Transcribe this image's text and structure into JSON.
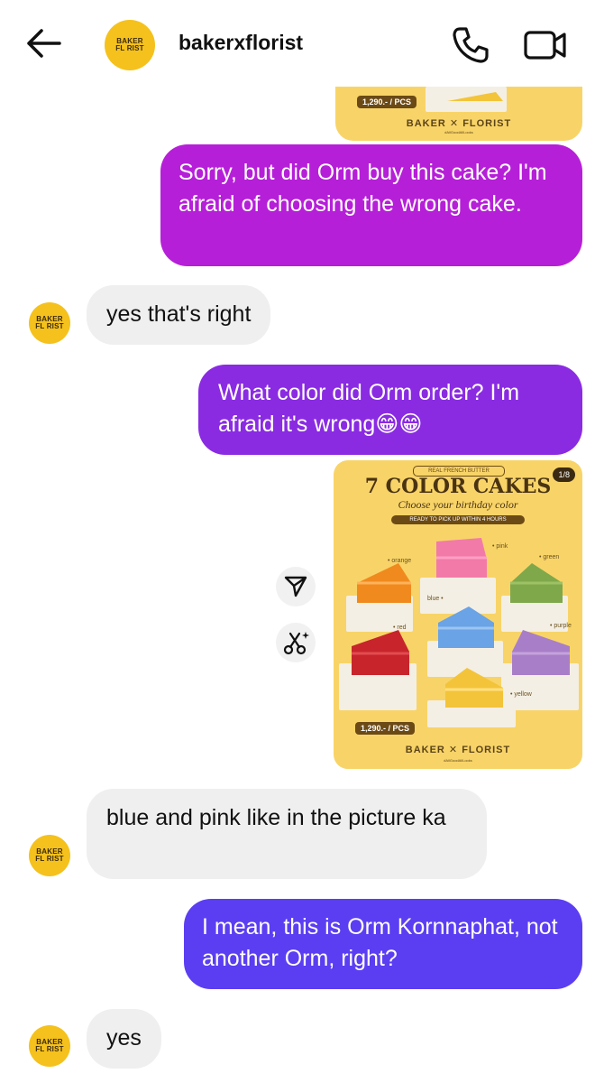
{
  "header": {
    "username": "bakerxflorist",
    "back_icon": "back-arrow-icon",
    "call_icon": "phone-icon",
    "video_icon": "video-camera-icon"
  },
  "logo": {
    "line1": "BAKER",
    "line2": "FL RIST"
  },
  "poster_top": {
    "price": "1,290.- / PCS",
    "brand": "BAKER ✕ FLORIST",
    "tagline": "#AllGoodAllLooks"
  },
  "messages": {
    "m1": "Sorry, but did Orm buy this cake? I'm afraid of choosing the wrong cake.",
    "m2": "yes that's right",
    "m3": "What color did Orm order? I'm afraid it's wrong😁😁",
    "m4": "blue and pink like in the picture ka",
    "m5": "I mean, this is Orm Kornnaphat, not another Orm, right?",
    "m6": "yes"
  },
  "poster_main": {
    "kicker": "REAL FRENCH BUTTER",
    "title": "7 COLOR CAKES",
    "subtitle": "Choose your birthday color",
    "badge": "READY TO PICK UP WITHIN 4 HOURS",
    "counter": "1/8",
    "price": "1,290.- / PCS",
    "brand": "BAKER ✕ FLORIST",
    "tagline": "#AllGoodAllLooks",
    "labels": {
      "orange": "• orange",
      "pink": "• pink",
      "green": "• green",
      "blue": "blue •",
      "red": "• red",
      "purple": "• purple",
      "yellow": "• yellow"
    }
  },
  "colors": {
    "bubble_pink": "#b61fd8",
    "bubble_purple": "#8a2be2",
    "bubble_indigo": "#5b3ef2",
    "bubble_in": "#efefef",
    "poster_bg": "#f8d468",
    "logo_bg": "#f5c11c"
  },
  "actions": {
    "share_icon": "share-send-icon",
    "remix_icon": "sparkle-scissors-icon"
  }
}
